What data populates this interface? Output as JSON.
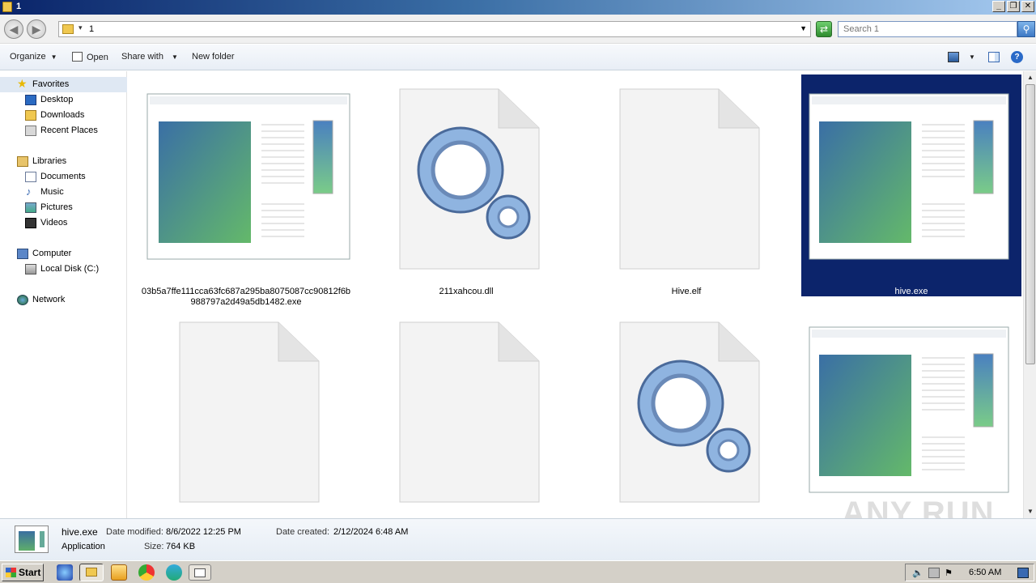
{
  "window": {
    "title": "1"
  },
  "address": {
    "path": "1"
  },
  "search": {
    "placeholder": "Search 1"
  },
  "toolbar": {
    "organize": "Organize",
    "open": "Open",
    "share_with": "Share with",
    "new_folder": "New folder"
  },
  "nav": {
    "favorites": "Favorites",
    "desktop": "Desktop",
    "downloads": "Downloads",
    "recent_places": "Recent Places",
    "libraries": "Libraries",
    "documents": "Documents",
    "music": "Music",
    "pictures": "Pictures",
    "videos": "Videos",
    "computer": "Computer",
    "local_disk": "Local Disk (C:)",
    "network": "Network"
  },
  "files": [
    {
      "name": "03b5a7ffe111cca63fc687a295ba8075087cc90812f6b988797a2d49a5db1482.exe",
      "icon": "application-window-icon",
      "selected": false
    },
    {
      "name": "211xahcou.dll",
      "icon": "gears-icon",
      "selected": false
    },
    {
      "name": "Hive.elf",
      "icon": "blank-file-icon",
      "selected": false
    },
    {
      "name": "hive.exe",
      "icon": "application-window-icon",
      "selected": true
    },
    {
      "name": "",
      "icon": "blank-file-icon",
      "selected": false
    },
    {
      "name": "",
      "icon": "blank-file-icon",
      "selected": false
    },
    {
      "name": "",
      "icon": "gears-icon",
      "selected": false
    },
    {
      "name": "",
      "icon": "application-window-icon",
      "selected": false
    }
  ],
  "details": {
    "name": "hive.exe",
    "type": "Application",
    "date_modified_label": "Date modified:",
    "date_modified": "8/6/2022 12:25 PM",
    "date_created_label": "Date created:",
    "date_created": "2/12/2024 6:48 AM",
    "size_label": "Size:",
    "size": "764 KB"
  },
  "taskbar": {
    "start": "Start",
    "clock": "6:50 AM"
  },
  "watermark": "ANY RUN",
  "colors": {
    "selection": "#0c246b",
    "titlebar": "#0a246a"
  }
}
